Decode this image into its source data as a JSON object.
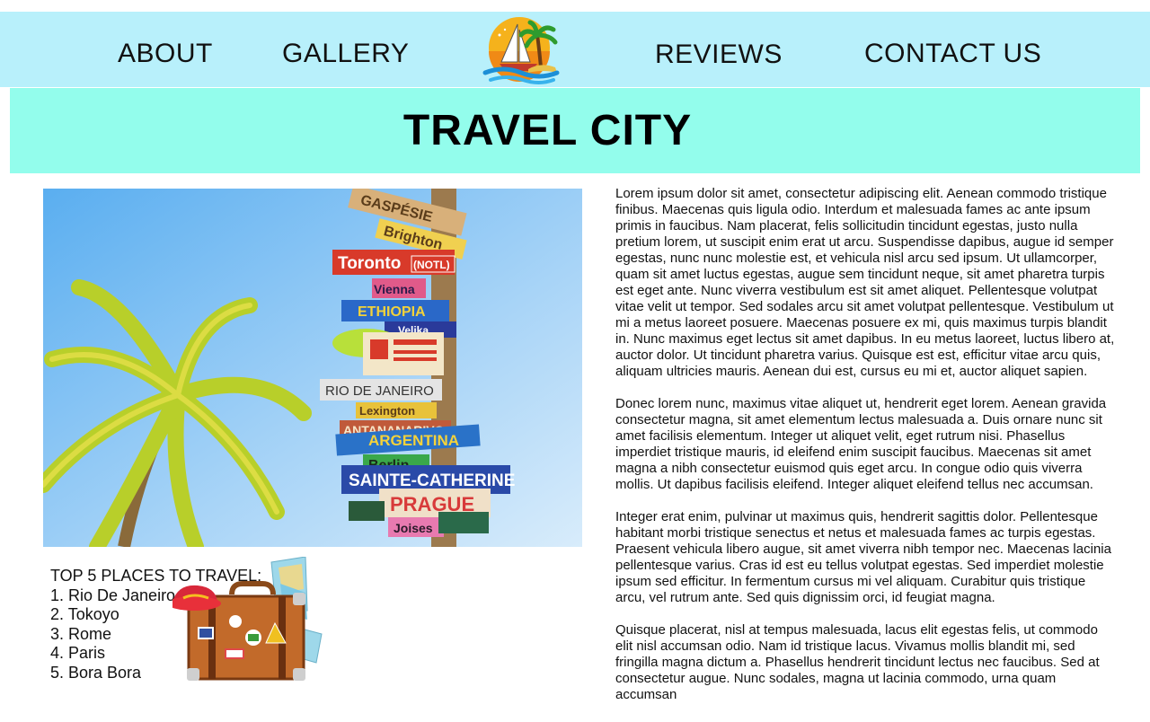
{
  "nav": {
    "items": [
      {
        "id": "about",
        "label": "ABOUT"
      },
      {
        "id": "gallery",
        "label": "GALLERY"
      },
      {
        "id": "reviews",
        "label": "REVIEWS"
      },
      {
        "id": "contact",
        "label": "CONTACT US"
      }
    ],
    "logo_icon": "beach-sunset-logo-icon"
  },
  "banner": {
    "title": "TRAVEL CITY"
  },
  "hero": {
    "image_icon": "palm-tree-signpost-photo",
    "signs": [
      "GASPÉSIE",
      "Brighton",
      "Toronto",
      "(NOTL)",
      "Vienna",
      "ETHIOPIA",
      "Velika",
      "RIO DE JANEIRO",
      "Lexington",
      "ANTANANARIVO",
      "ARGENTINA",
      "Berlin",
      "SAINTE-CATHERINE",
      "PRAGUE",
      "Joises"
    ]
  },
  "places": {
    "heading": "TOP 5 PLACES TO TRAVEL:",
    "items": [
      "1. Rio De Janeiro",
      "2. Tokoyo",
      "3. Rome",
      "4. Paris",
      "5. Bora Bora"
    ],
    "illustration_icon": "suitcase-hat-map-icon"
  },
  "article": {
    "paragraphs": [
      "Lorem ipsum dolor sit amet, consectetur adipiscing elit. Aenean commodo tristique finibus. Maecenas quis ligula odio. Interdum et malesuada fames ac ante ipsum primis in faucibus. Nam placerat, felis sollicitudin tincidunt egestas, justo nulla pretium lorem, ut suscipit enim erat ut arcu. Suspendisse dapibus, augue id semper egestas, nunc nunc molestie est, et vehicula nisl arcu sed ipsum. Ut ullamcorper, quam sit amet luctus egestas, augue sem tincidunt neque, sit amet pharetra turpis est eget ante. Nunc viverra vestibulum est sit amet aliquet. Pellentesque volutpat vitae velit ut tempor. Sed sodales arcu sit amet volutpat pellentesque. Vestibulum ut mi a metus laoreet posuere. Maecenas posuere ex mi, quis maximus turpis blandit in. Nunc maximus eget lectus sit amet dapibus. In eu metus laoreet, luctus libero at, auctor dolor. Ut tincidunt pharetra varius. Quisque est est, efficitur vitae arcu quis, aliquam ultricies mauris. Aenean dui est, cursus eu mi et, auctor aliquet sapien.",
      "Donec lorem nunc, maximus vitae aliquet ut, hendrerit eget lorem. Aenean gravida consectetur magna, sit amet elementum lectus malesuada a. Duis ornare nunc sit amet facilisis elementum. Integer ut aliquet velit, eget rutrum nisi. Phasellus imperdiet tristique mauris, id eleifend enim suscipit faucibus. Maecenas sit amet magna a nibh consectetur euismod quis eget arcu. In congue odio quis viverra mollis. Ut dapibus facilisis eleifend. Integer aliquet eleifend tellus nec accumsan.",
      "Integer erat enim, pulvinar ut maximus quis, hendrerit sagittis dolor. Pellentesque habitant morbi tristique senectus et netus et malesuada fames ac turpis egestas. Praesent vehicula libero augue, sit amet viverra nibh tempor nec. Maecenas lacinia pellentesque varius. Cras id est eu tellus volutpat egestas. Sed imperdiet molestie ipsum sed efficitur. In fermentum cursus mi vel aliquam. Curabitur quis tristique arcu, vel rutrum ante. Sed quis dignissim orci, id feugiat magna.",
      "Quisque placerat, nisl at tempus malesuada, lacus elit egestas felis, ut commodo elit nisl accumsan odio. Nam id tristique lacus. Vivamus mollis blandit mi, sed fringilla magna dictum a. Phasellus hendrerit tincidunt lectus nec faucibus. Sed at consectetur augue. Nunc sodales, magna ut lacinia commodo, urna quam accumsan"
    ]
  },
  "colors": {
    "nav_bg": "#b8f0fb",
    "banner_bg": "#93fdec",
    "sky": "#8ec9f5",
    "palm_leaf": "#b8cf2a",
    "sun": "#f5b21c"
  }
}
